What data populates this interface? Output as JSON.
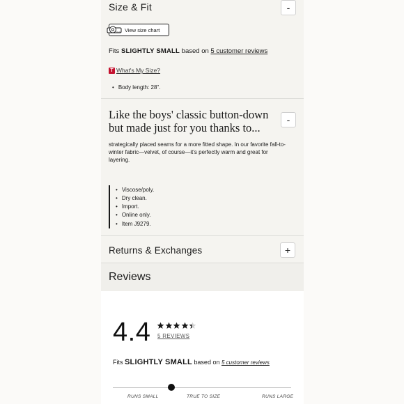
{
  "size_fit": {
    "title": "Size & Fit",
    "toggle_label": "-",
    "size_chart_label": "View size chart",
    "fit_prefix": "Fits ",
    "fit_value": "SLIGHTLY SMALL",
    "fit_mid": " based on ",
    "fit_link": "5 customer reviews",
    "whats_my_size_badge": "T",
    "whats_my_size": "What's My Size?",
    "bullets": [
      "Body length: 28\"."
    ]
  },
  "description": {
    "heading": "Like the boys' classic button-down but made just for you thanks to...",
    "toggle_label": "-",
    "body": "strategically placed seams for a more fitted shape. In our favorite fall-to-winter fabric—velvet, of course—it's perfectly warm and great for layering.",
    "specs": [
      "Viscose/poly.",
      "Dry clean.",
      "Import.",
      "Online only.",
      "Item J9279."
    ]
  },
  "returns": {
    "title": "Returns & Exchanges",
    "toggle_label": "+"
  },
  "reviews": {
    "title": "Reviews",
    "rating": "4.4",
    "rating_value": 4.4,
    "rating_max": 5,
    "count_label": "5 REVIEWS",
    "fit_prefix": "Fits ",
    "fit_value": "SLIGHTLY SMALL",
    "fit_mid": " based on ",
    "fit_link": "5 customer reviews",
    "fit_scale_position": 0.33,
    "scale_labels": [
      "RUNS SMALL",
      "TRUE TO SIZE",
      "RUNS LARGE"
    ]
  },
  "colors": {
    "star_filled": "#1a1a1a",
    "star_empty": "#d0d0d0",
    "badge": "#c4122f"
  }
}
